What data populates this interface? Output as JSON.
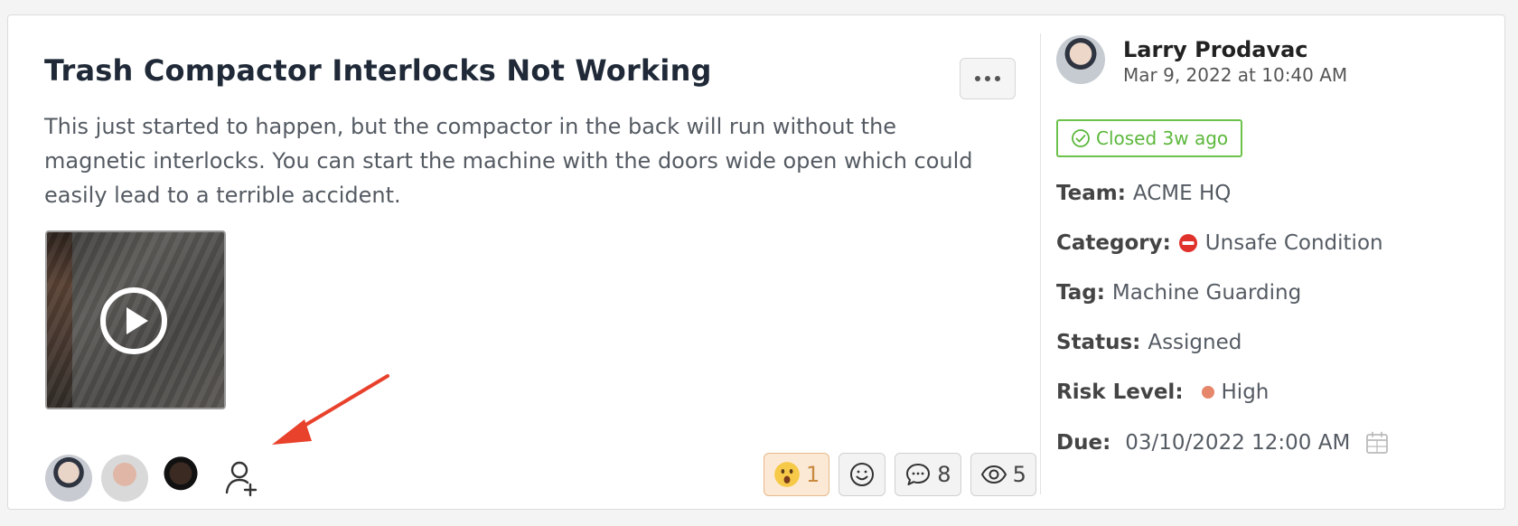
{
  "post": {
    "title": "Trash Compactor Interlocks Not Working",
    "description": "This just started to happen, but the compactor in the back will run without the magnetic interlocks. You can start the machine with the doors wide open which could easily lead to a terrible accident."
  },
  "reactions": {
    "surprised_count": "1",
    "comments_count": "8",
    "views_count": "5"
  },
  "sidebar": {
    "author_name": "Larry Prodavac",
    "author_date": "Mar 9, 2022 at 10:40 AM",
    "status_badge": "Closed 3w ago",
    "team_label": "Team:",
    "team_value": "ACME HQ",
    "category_label": "Category:",
    "category_value": "Unsafe Condition",
    "tag_label": "Tag:",
    "tag_value": "Machine Guarding",
    "status_label": "Status:",
    "status_value": "Assigned",
    "risk_label": "Risk Level:",
    "risk_value": "High",
    "due_label": "Due:",
    "due_value": "03/10/2022 12:00 AM"
  },
  "colors": {
    "badge_green": "#5cb83c",
    "risk_high": "#e6866b",
    "annotation_arrow": "#e8412c",
    "reaction_active": "#c98a3f"
  },
  "icons": [
    "more-icon",
    "play-icon",
    "add-user-icon",
    "surprised-emoji-icon",
    "add-reaction-icon",
    "comment-icon",
    "eye-icon",
    "check-circle-icon",
    "no-entry-icon",
    "calendar-icon",
    "annotation-arrow"
  ]
}
